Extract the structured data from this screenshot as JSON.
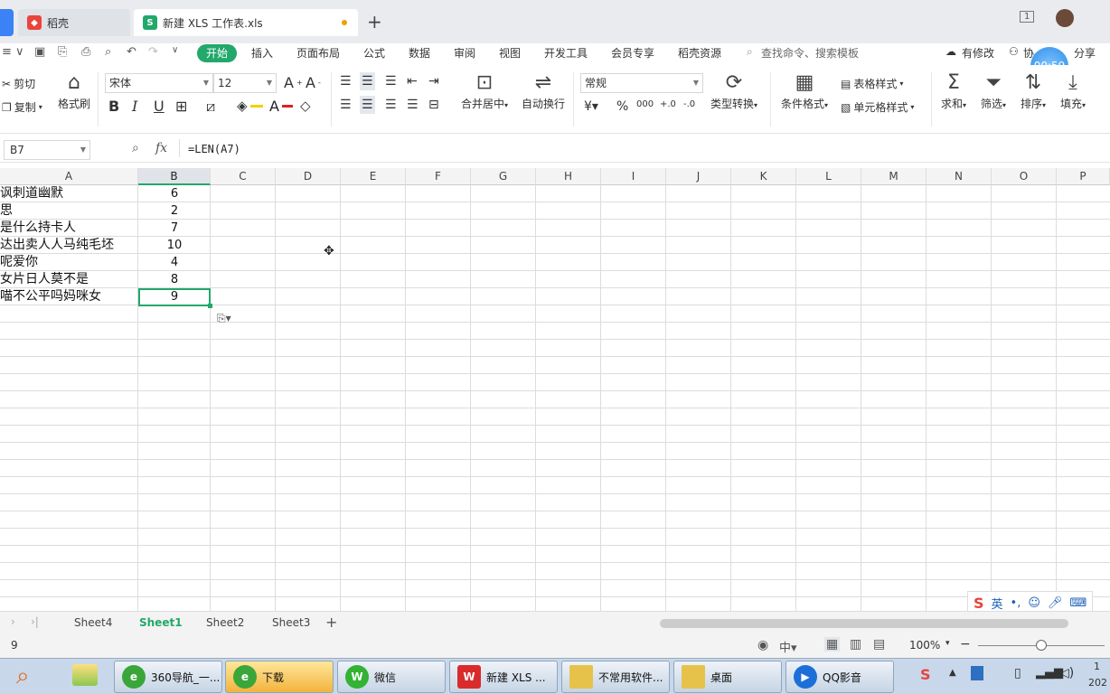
{
  "tabs": {
    "inactive_label": "稻壳",
    "active_label": "新建 XLS 工作表.xls",
    "add": "+"
  },
  "window": {
    "page_indicator": "1"
  },
  "menu": {
    "start": "开始",
    "items": [
      "插入",
      "页面布局",
      "公式",
      "数据",
      "审阅",
      "视图",
      "开发工具",
      "会员专享",
      "稻壳资源"
    ],
    "search": "查找命令、搜索模板",
    "right": [
      "有修改",
      "协",
      "分享"
    ]
  },
  "timer": "00:59",
  "ribbon": {
    "cut": "剪切",
    "copy": "复制",
    "format_painter": "格式刷",
    "font_name": "宋体",
    "font_size": "12",
    "merge_center": "合并居中",
    "wrap": "自动换行",
    "number_format": "常规",
    "type_convert": "类型转换",
    "cond_format": "条件格式",
    "table_style": "表格样式",
    "cell_style": "单元格样式",
    "sum": "求和",
    "filter": "筛选",
    "sort": "排序",
    "fill": "填充"
  },
  "formula_bar": {
    "name_box": "B7",
    "fx": "fx",
    "formula": "=LEN(A7)"
  },
  "columns": [
    "A",
    "B",
    "C",
    "D",
    "E",
    "F",
    "G",
    "H",
    "I",
    "J",
    "K",
    "L",
    "M",
    "N",
    "O",
    "P"
  ],
  "rows": [
    {
      "a": "讽刺道幽默",
      "b": "6"
    },
    {
      "a": "思",
      "b": "2"
    },
    {
      "a": "是什么持卡人",
      "b": "7"
    },
    {
      "a": "达出卖人人马纯毛坯",
      "b": "10"
    },
    {
      "a": "呢爱你",
      "b": "4"
    },
    {
      "a": "女片日人莫不是",
      "b": "8"
    },
    {
      "a": "喵不公平吗妈咪女",
      "b": "9"
    }
  ],
  "sheets": [
    "Sheet4",
    "Sheet1",
    "Sheet2",
    "Sheet3"
  ],
  "active_sheet": "Sheet1",
  "status": {
    "value": "9",
    "zoom": "100%"
  },
  "ime": {
    "lang": "英"
  },
  "taskbar": {
    "items": [
      "360导航_一...",
      "下载",
      "微信",
      "新建 XLS ...",
      "不常用软件...",
      "桌面",
      "QQ影音"
    ],
    "clock": "1",
    "year": "202"
  },
  "colors": {
    "accent": "#22a86b"
  }
}
